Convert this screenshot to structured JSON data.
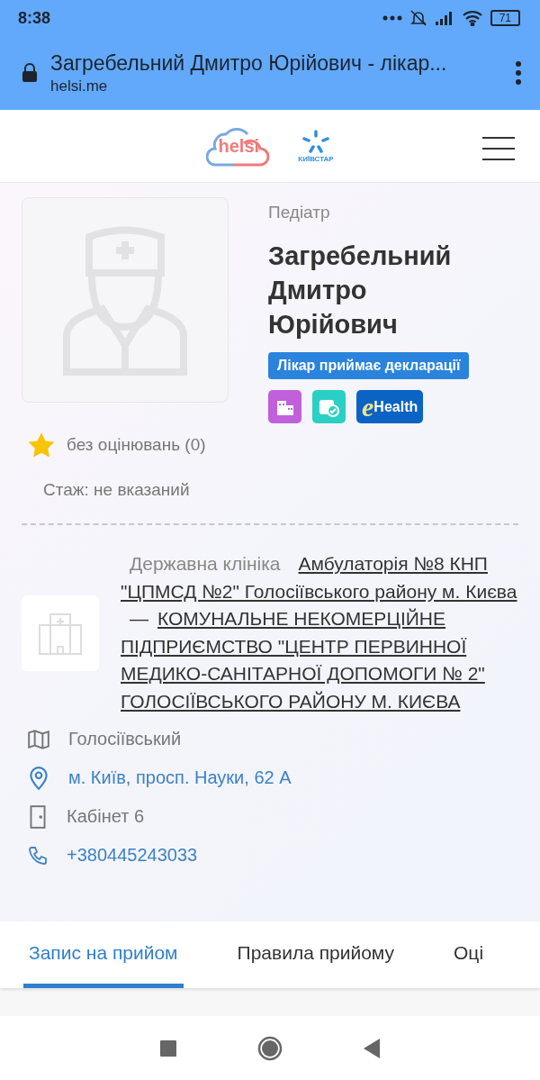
{
  "status_bar": {
    "time": "8:38",
    "battery": "71"
  },
  "browser": {
    "title": "Загребельний Дмитро Юрійович - лікар...",
    "url": "helsi.me"
  },
  "header": {
    "logo": "helsi",
    "partner_logo": "КИЇВСТАР"
  },
  "doctor": {
    "specialty": "Педіатр",
    "name": "Загребельний Дмитро Юрійович",
    "declaration_badge": "Лікар приймає декларації",
    "ehealth_badge": {
      "mark": "e",
      "label": "Health"
    },
    "rating": "без оцінювань (0)",
    "experience": "Стаж: не вказаний"
  },
  "clinic": {
    "type": "Державна клініка",
    "name": "Амбулаторія №8 КНП \"ЦПМСД №2\" Голосіївського району м. Києва",
    "separator": "—",
    "organization": "КОМУНАЛЬНЕ НЕКОМЕРЦІЙНЕ ПІДПРИЄМСТВО \"ЦЕНТР ПЕРВИННОЇ МЕДИКО-САНІТАРНОЇ ДОПОМОГИ № 2\" ГОЛОСІЇВСЬКОГО РАЙОНУ М. КИЄВА"
  },
  "contacts": [
    {
      "kind": "district",
      "text": "Голосіївський"
    },
    {
      "kind": "address",
      "text": "м. Київ, просп. Науки, 62 А"
    },
    {
      "kind": "room",
      "text": "Кабінет 6"
    },
    {
      "kind": "phone",
      "text": "+380445243033"
    }
  ],
  "tabs": [
    {
      "label": "Запис на прийом",
      "selected": true
    },
    {
      "label": "Правила прийому",
      "selected": false
    },
    {
      "label": "Оці",
      "selected": false
    }
  ]
}
